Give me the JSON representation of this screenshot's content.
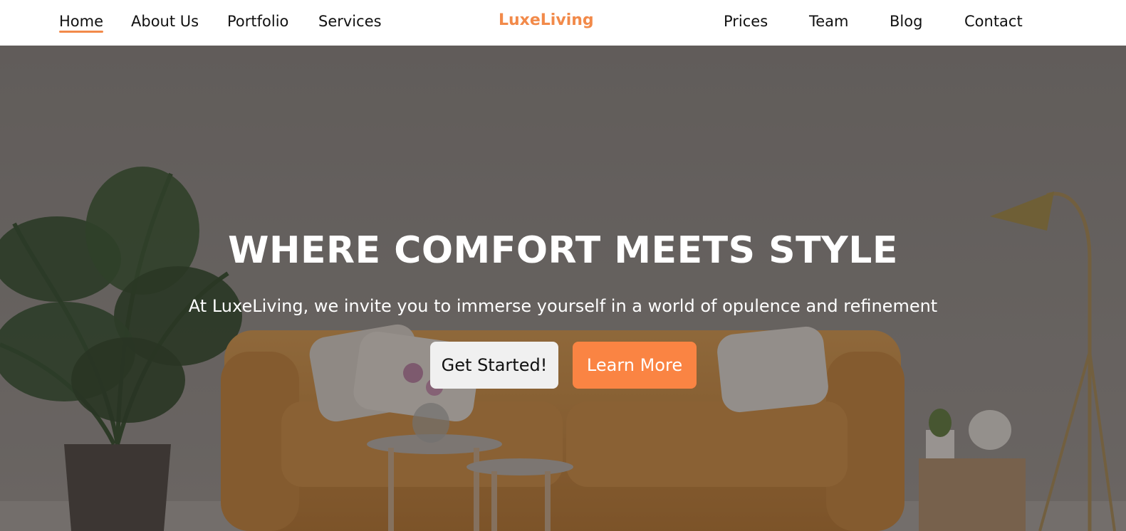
{
  "colors": {
    "accent": "#f28a4a",
    "primary_button": "#fa8443",
    "secondary_button": "#f0f0f0",
    "nav_text": "#111111"
  },
  "nav": {
    "left": [
      {
        "label": "Home",
        "active": true
      },
      {
        "label": "About Us"
      },
      {
        "label": "Portfolio"
      },
      {
        "label": "Services"
      }
    ],
    "brand": "LuxeLiving",
    "right": [
      {
        "label": "Prices"
      },
      {
        "label": "Team"
      },
      {
        "label": "Blog"
      },
      {
        "label": "Contact"
      }
    ]
  },
  "hero": {
    "title": "WHERE COMFORT MEETS STYLE",
    "subtitle": "At LuxeLiving, we invite you to immerse yourself in a world of opulence and refinement",
    "primary_cta": "Get Started!",
    "secondary_cta": "Learn More"
  }
}
